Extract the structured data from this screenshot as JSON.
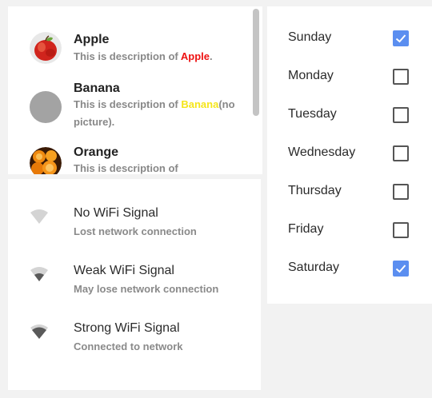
{
  "fruits": [
    {
      "title": "Apple",
      "desc_prefix": "This is description of ",
      "highlight": "Apple",
      "desc_suffix": ".",
      "avatar": "apple-image"
    },
    {
      "title": "Banana",
      "desc_prefix": "This is description of ",
      "highlight": "Banana",
      "desc_suffix": "(no picture).",
      "avatar": "placeholder-circle"
    },
    {
      "title": "Orange",
      "desc_prefix": "This is description of ",
      "highlight": "",
      "desc_suffix": "",
      "avatar": "orange-image"
    }
  ],
  "wifi": [
    {
      "title": "No WiFi Signal",
      "subtitle": "Lost network connection",
      "strength": 0
    },
    {
      "title": "Weak WiFi Signal",
      "subtitle": "May lose network connection",
      "strength": 1
    },
    {
      "title": "Strong WiFi Signal",
      "subtitle": "Connected to network",
      "strength": 2
    }
  ],
  "days": [
    {
      "label": "Sunday",
      "checked": true
    },
    {
      "label": "Monday",
      "checked": false
    },
    {
      "label": "Tuesday",
      "checked": false
    },
    {
      "label": "Wednesday",
      "checked": false
    },
    {
      "label": "Thursday",
      "checked": false
    },
    {
      "label": "Friday",
      "checked": false
    },
    {
      "label": "Saturday",
      "checked": true
    }
  ],
  "colors": {
    "checkbox_checked": "#5b8ef0",
    "highlight_red": "#ee1111",
    "highlight_yellow": "#f5e51b"
  }
}
